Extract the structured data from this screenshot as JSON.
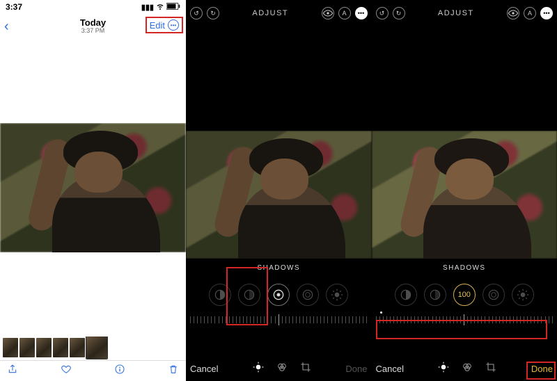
{
  "panel1": {
    "status_time": "3:37",
    "status_icons": [
      "signal-icon",
      "wifi-icon",
      "battery-icon"
    ],
    "nav": {
      "title": "Today",
      "subtitle": "3:37 PM",
      "edit": "Edit"
    },
    "toolbar_icons": [
      "share-icon",
      "heart-icon",
      "info-icon",
      "trash-icon"
    ]
  },
  "panel2": {
    "top_left_icons": [
      "undo-icon",
      "redo-icon"
    ],
    "top_heading": "ADJUST",
    "top_right_icons": [
      "eye-icon",
      "auto-icon",
      "more-solid-icon"
    ],
    "tool_label": "SHADOWS",
    "bottom": {
      "left": "Cancel",
      "right": "Done"
    }
  },
  "panel3": {
    "top_left_icons": [
      "undo-icon",
      "redo-icon"
    ],
    "top_heading": "ADJUST",
    "top_right_icons": [
      "eye-icon",
      "auto-icon",
      "more-solid-icon"
    ],
    "tool_label": "SHADOWS",
    "selected_value": "100",
    "bottom": {
      "left": "Cancel",
      "right": "Done"
    }
  },
  "colors": {
    "accent_ios": "#2f6fe0",
    "callout": "#d52626",
    "gold": "#e8b731"
  }
}
